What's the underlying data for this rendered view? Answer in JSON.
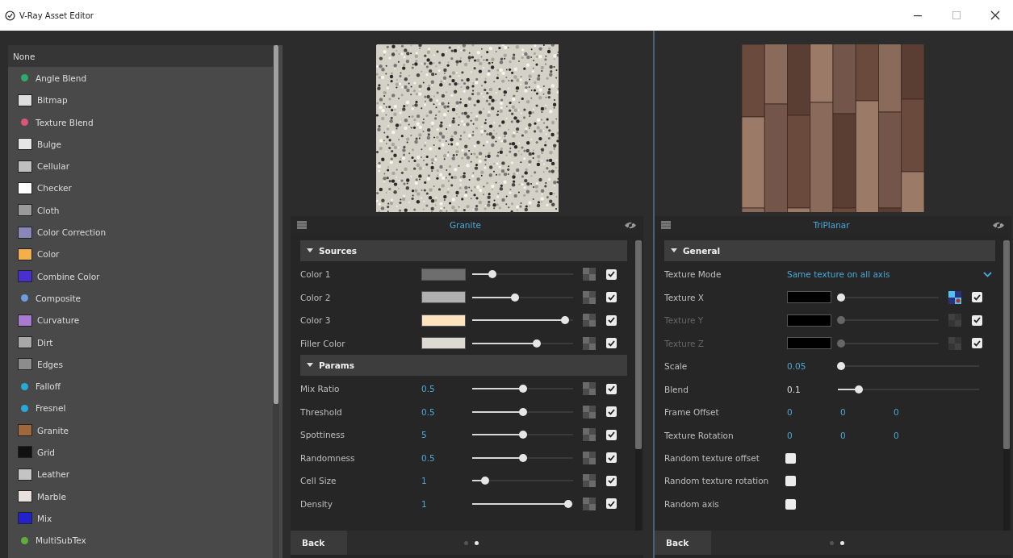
{
  "window": {
    "title": "V-Ray Asset Editor"
  },
  "texture_list": {
    "items": [
      {
        "label": "None",
        "selected": true,
        "kind": "none"
      },
      {
        "label": "Angle Blend",
        "selected": false,
        "kind": "dot",
        "color": "#2eaa6e"
      },
      {
        "label": "Bitmap",
        "selected": false,
        "kind": "tile",
        "color": "#dddddd"
      },
      {
        "label": "Texture Blend",
        "selected": false,
        "kind": "dot",
        "color": "#d8577a"
      },
      {
        "label": "Bulge",
        "selected": false,
        "kind": "tile",
        "color": "#e6e6e6"
      },
      {
        "label": "Cellular",
        "selected": false,
        "kind": "tile",
        "color": "#bfbfbf"
      },
      {
        "label": "Checker",
        "selected": false,
        "kind": "tile",
        "color": "#ffffff"
      },
      {
        "label": "Cloth",
        "selected": false,
        "kind": "tile",
        "color": "#9a9a9a"
      },
      {
        "label": "Color Correction",
        "selected": false,
        "kind": "tile",
        "color": "#8a86b8"
      },
      {
        "label": "Color",
        "selected": false,
        "kind": "tile",
        "color": "#f3b04a"
      },
      {
        "label": "Combine Color",
        "selected": false,
        "kind": "tile",
        "color": "#4a2fd0"
      },
      {
        "label": "Composite",
        "selected": false,
        "kind": "dot",
        "color": "#6b9de0"
      },
      {
        "label": "Curvature",
        "selected": false,
        "kind": "tile",
        "color": "#a67bd0"
      },
      {
        "label": "Dirt",
        "selected": false,
        "kind": "tile",
        "color": "#a8a8a8"
      },
      {
        "label": "Edges",
        "selected": false,
        "kind": "tile",
        "color": "#8c8c8c"
      },
      {
        "label": "Falloff",
        "selected": false,
        "kind": "dot",
        "color": "#29a9d8"
      },
      {
        "label": "Fresnel",
        "selected": false,
        "kind": "dot",
        "color": "#29a9d8"
      },
      {
        "label": "Granite",
        "selected": false,
        "kind": "tile",
        "color": "#a0683a"
      },
      {
        "label": "Grid",
        "selected": false,
        "kind": "tile",
        "color": "#111111"
      },
      {
        "label": "Leather",
        "selected": false,
        "kind": "tile",
        "color": "#c4c4c4"
      },
      {
        "label": "Marble",
        "selected": false,
        "kind": "tile",
        "color": "#e8e0dc"
      },
      {
        "label": "Mix",
        "selected": false,
        "kind": "tile",
        "color": "#2222cc"
      },
      {
        "label": "MultiSubTex",
        "selected": false,
        "kind": "dot",
        "color": "#5fae3a"
      }
    ]
  },
  "editors": [
    {
      "preview": {
        "kind": "granite"
      },
      "title": "Granite",
      "sections": [
        {
          "title": "Sources",
          "expanded": true,
          "rows": [
            {
              "kind": "color",
              "label": "Color 1",
              "color": "#6e6e6e",
              "level": 0.2,
              "mapped": false,
              "checked": true
            },
            {
              "kind": "color",
              "label": "Color 2",
              "color": "#b0b0b0",
              "level": 0.42,
              "mapped": false,
              "checked": true
            },
            {
              "kind": "color",
              "label": "Color 3",
              "color": "#fde4bf",
              "level": 0.92,
              "mapped": false,
              "checked": true
            },
            {
              "kind": "color",
              "label": "Filler Color",
              "color": "#dcdad2",
              "level": 0.64,
              "mapped": false,
              "checked": true
            }
          ]
        },
        {
          "title": "Params",
          "expanded": true,
          "rows": [
            {
              "kind": "param",
              "label": "Mix Ratio",
              "value": "0.5",
              "level": 0.5,
              "mapped": false,
              "checked": true
            },
            {
              "kind": "param",
              "label": "Threshold",
              "value": "0.5",
              "level": 0.5,
              "mapped": false,
              "checked": true
            },
            {
              "kind": "param",
              "label": "Spottiness",
              "value": "5",
              "level": 0.5,
              "mapped": false,
              "checked": true
            },
            {
              "kind": "param",
              "label": "Randomness",
              "value": "0.5",
              "level": 0.5,
              "mapped": false,
              "checked": true
            },
            {
              "kind": "param",
              "label": "Cell Size",
              "value": "1",
              "level": 0.13,
              "mapped": false,
              "checked": true
            },
            {
              "kind": "param",
              "label": "Density",
              "value": "1",
              "level": 0.95,
              "mapped": false,
              "checked": true
            }
          ]
        }
      ],
      "back": "Back",
      "pages": [
        {
          "selected": false
        },
        {
          "selected": true
        }
      ]
    },
    {
      "preview": {
        "kind": "wood"
      },
      "title": "TriPlanar",
      "sections": [
        {
          "title": "General",
          "expanded": true,
          "rows": [
            {
              "kind": "dropdown",
              "label": "Texture Mode",
              "value": "Same texture on all axis"
            },
            {
              "kind": "texture",
              "label": "Texture X",
              "color": "#000000",
              "level": 0.03,
              "disabled": false,
              "mapped": true,
              "checked": true
            },
            {
              "kind": "texture",
              "label": "Texture Y",
              "color": "#000000",
              "level": 0.03,
              "disabled": true,
              "mapped": false,
              "checked": true
            },
            {
              "kind": "texture",
              "label": "Texture Z",
              "color": "#000000",
              "level": 0.03,
              "disabled": true,
              "mapped": false,
              "checked": true
            },
            {
              "kind": "slider",
              "label": "Scale",
              "value": "0.05",
              "level": 0.02
            },
            {
              "kind": "slider",
              "label": "Blend",
              "value": "0.1",
              "level": 0.15
            },
            {
              "kind": "triple",
              "label": "Frame Offset",
              "values": [
                "0",
                "0",
                "0"
              ]
            },
            {
              "kind": "triple",
              "label": "Texture Rotation",
              "values": [
                "0",
                "0",
                "0"
              ]
            },
            {
              "kind": "toggle",
              "label": "Random texture offset",
              "checked": false
            },
            {
              "kind": "toggle",
              "label": "Random texture rotation",
              "checked": false
            },
            {
              "kind": "toggle",
              "label": "Random axis",
              "checked": false
            }
          ]
        }
      ],
      "back": "Back",
      "pages": [
        {
          "selected": false
        },
        {
          "selected": true
        }
      ]
    }
  ]
}
